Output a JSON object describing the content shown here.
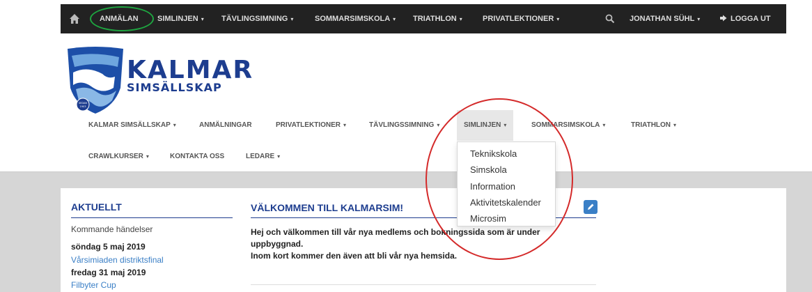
{
  "topbar": {
    "items": [
      {
        "label": "ANMÄLAN",
        "caret": false
      },
      {
        "label": "SIMLINJEN",
        "caret": true
      },
      {
        "label": "TÄVLINGSIMNING",
        "caret": true
      },
      {
        "label": "SOMMARSIMSKOLA",
        "caret": true
      },
      {
        "label": "TRIATHLON",
        "caret": true
      },
      {
        "label": "PRIVATLEKTIONER",
        "caret": true
      }
    ],
    "user": "JONATHAN SÜHL",
    "logout": "LOGGA UT",
    "caret": "▾"
  },
  "logo": {
    "title": "KALMAR",
    "subtitle": "SIMSÄLLSKAP",
    "badge_line1": "SEDAN",
    "badge_line2": "1903"
  },
  "mainnav": {
    "row1": [
      "KALMAR SIMSÄLLSKAP",
      "ANMÄLNINGAR",
      "PRIVATLEKTIONER",
      "TÄVLINGSSIMNING",
      "SIMLINJEN",
      "SOMMARSIMSKOLA",
      "TRIATHLON"
    ],
    "row2": [
      "CRAWLKURSER",
      "KONTAKTA OSS",
      "LEDARE"
    ]
  },
  "dropdown": [
    "Teknikskola",
    "Simskola",
    "Information",
    "Aktivitetskalender",
    "Microsim"
  ],
  "sidebar": {
    "title": "AKTUELLT",
    "subtitle": "Kommande händelser",
    "events": [
      {
        "date": "söndag 5 maj 2019",
        "name": "Vårsimiaden distriktsfinal"
      },
      {
        "date": "fredag 31 maj 2019",
        "name": "Filbyter Cup"
      }
    ]
  },
  "welcome": {
    "title": "VÄLKOMMEN TILL KALMARSIM!",
    "lines": [
      "Hej och välkommen till vår nya medlems och bokningssida som är under",
      "uppbyggnad.",
      "Inom kort kommer den även att bli vår nya hemsida."
    ]
  },
  "colors": {
    "brand": "#1d3d8f",
    "link": "#3a7fc6",
    "annotation_green": "#1ea540",
    "annotation_red": "#d42a2a"
  }
}
